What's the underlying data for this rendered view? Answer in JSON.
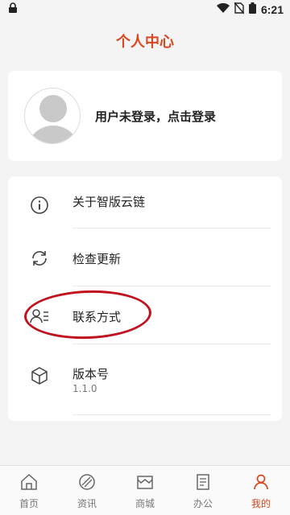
{
  "status_bar": {
    "time": "6:21"
  },
  "header": {
    "title": "个人中心"
  },
  "profile": {
    "login_prompt": "用户未登录，点击登录"
  },
  "menu": {
    "items": [
      {
        "label": "关于智版云链",
        "icon": "info-icon"
      },
      {
        "label": "检查更新",
        "icon": "refresh-icon"
      },
      {
        "label": "联系方式",
        "icon": "contacts-icon"
      },
      {
        "label": "版本号",
        "sub": "1.1.0",
        "icon": "cube-icon"
      }
    ]
  },
  "tabs": [
    {
      "label": "首页",
      "icon": "home-icon",
      "active": false
    },
    {
      "label": "资讯",
      "icon": "news-icon",
      "active": false
    },
    {
      "label": "商城",
      "icon": "store-icon",
      "active": false
    },
    {
      "label": "办公",
      "icon": "office-icon",
      "active": false
    },
    {
      "label": "我的",
      "icon": "person-icon",
      "active": true
    }
  ],
  "colors": {
    "accent": "#d9461e",
    "annotation": "#c1121f"
  }
}
